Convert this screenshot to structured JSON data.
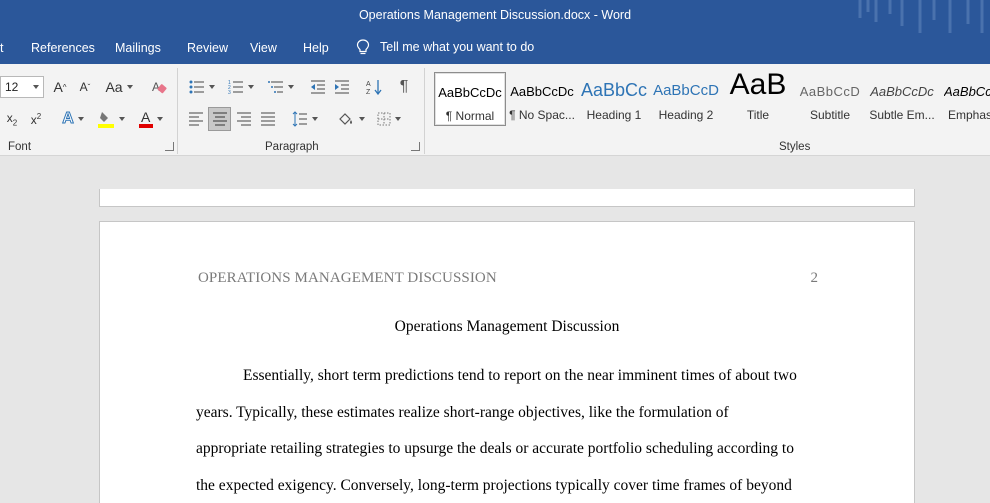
{
  "window": {
    "title": "Operations Management Discussion.docx  -  Word"
  },
  "menu": {
    "items": [
      "t",
      "References",
      "Mailings",
      "Review",
      "View",
      "Help"
    ],
    "tell_me": "Tell me what you want to do"
  },
  "ribbon": {
    "font": {
      "size": "12",
      "label": "Font",
      "grow_glyph": "A",
      "shrink_glyph": "A",
      "case_glyph": "Aa",
      "text_effects_glyph": "A",
      "font_color_glyph": "A",
      "highlight_color": "#ffff00",
      "font_color": "#e00000"
    },
    "paragraph": {
      "label": "Paragraph",
      "show_marks_glyph": "¶"
    },
    "styles": {
      "label": "Styles",
      "items": [
        {
          "preview": "AaBbCcDc",
          "name": "¶ Normal"
        },
        {
          "preview": "AaBbCcDc",
          "name": "¶ No Spac..."
        },
        {
          "preview": "AaBbCc",
          "name": "Heading 1"
        },
        {
          "preview": "AaBbCcD",
          "name": "Heading 2"
        },
        {
          "preview": "AaB",
          "name": "Title"
        },
        {
          "preview": "AaBbCcD",
          "name": "Subtitle"
        },
        {
          "preview": "AaBbCcDc",
          "name": "Subtle Em..."
        },
        {
          "preview": "AaBbCc",
          "name": "Emphasis"
        }
      ]
    }
  },
  "document": {
    "header": "OPERATIONS MANAGEMENT DISCUSSION",
    "page_number": "2",
    "title": "Operations Management Discussion",
    "lines": [
      "Essentially, short term predictions tend to report on the near imminent times of about two",
      "years. Typically, these estimates realize short-range objectives, like the formulation of",
      "appropriate retailing strategies to upsurge the deals or accurate portfolio scheduling according to",
      "the expected exigency. Conversely, long-term projections typically cover time frames of beyond"
    ]
  },
  "colors": {
    "accent": "#2b579a",
    "ribbon_bg": "#f3f3f3",
    "heading_blue": "#2e74b5"
  }
}
